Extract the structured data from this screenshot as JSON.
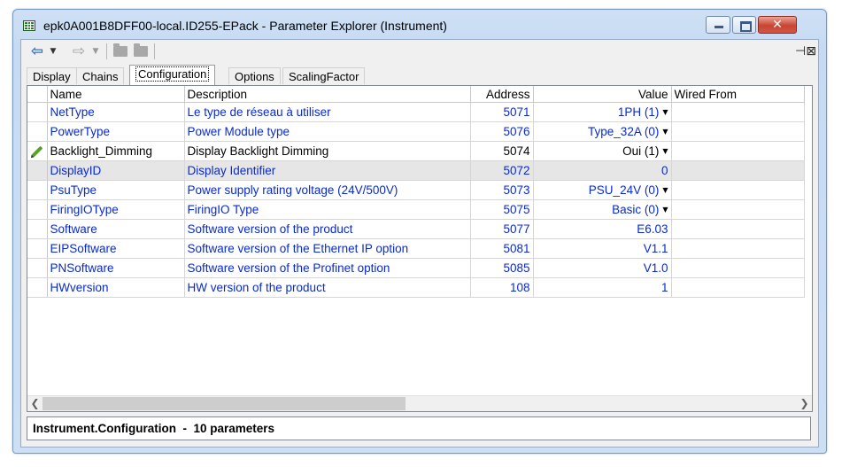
{
  "window": {
    "title": "epk0A001B8DFF00-local.ID255-EPack - Parameter Explorer (Instrument)"
  },
  "toolbar": {
    "back_icon": "arrow-left-icon",
    "forward_icon": "arrow-right-icon",
    "folder_icon": "folder-icon",
    "pin_icon": "pin-icon"
  },
  "tabs": [
    {
      "label": "Display"
    },
    {
      "label": "Chains"
    },
    {
      "label": "Configuration"
    },
    {
      "label": "Options"
    },
    {
      "label": "ScalingFactor"
    }
  ],
  "active_tab": "Configuration",
  "columns": {
    "name": "Name",
    "description": "Description",
    "address": "Address",
    "value": "Value",
    "wired_from": "Wired From"
  },
  "rows": [
    {
      "name": "NetType",
      "description": "Le type de réseau à utiliser",
      "address": "5071",
      "value": "1PH (1)",
      "dropdown": true,
      "wired_from": ""
    },
    {
      "name": "PowerType",
      "description": "Power Module type",
      "address": "5076",
      "value": "Type_32A (0)",
      "dropdown": true,
      "wired_from": ""
    },
    {
      "name": "Backlight_Dimming",
      "description": "Display Backlight Dimming",
      "address": "5074",
      "value": "Oui (1)",
      "dropdown": true,
      "wired_from": ""
    },
    {
      "name": "DisplayID",
      "description": "Display Identifier",
      "address": "5072",
      "value": "0",
      "dropdown": false,
      "wired_from": ""
    },
    {
      "name": "PsuType",
      "description": "Power supply rating voltage (24V/500V)",
      "address": "5073",
      "value": "PSU_24V (0)",
      "dropdown": true,
      "wired_from": ""
    },
    {
      "name": "FiringIOType",
      "description": "FiringIO Type",
      "address": "5075",
      "value": "Basic (0)",
      "dropdown": true,
      "wired_from": ""
    },
    {
      "name": "Software",
      "description": "Software version of the product",
      "address": "5077",
      "value": "E6.03",
      "dropdown": false,
      "wired_from": ""
    },
    {
      "name": "EIPSoftware",
      "description": "Software version of the Ethernet IP option",
      "address": "5081",
      "value": "V1.1",
      "dropdown": false,
      "wired_from": ""
    },
    {
      "name": "PNSoftware",
      "description": "Software version of the Profinet option",
      "address": "5085",
      "value": "V1.0",
      "dropdown": false,
      "wired_from": ""
    },
    {
      "name": "HWversion",
      "description": "HW version of the product",
      "address": "108",
      "value": "1",
      "dropdown": false,
      "wired_from": ""
    }
  ],
  "status": {
    "text": "Instrument.Configuration  -  10 parameters"
  }
}
